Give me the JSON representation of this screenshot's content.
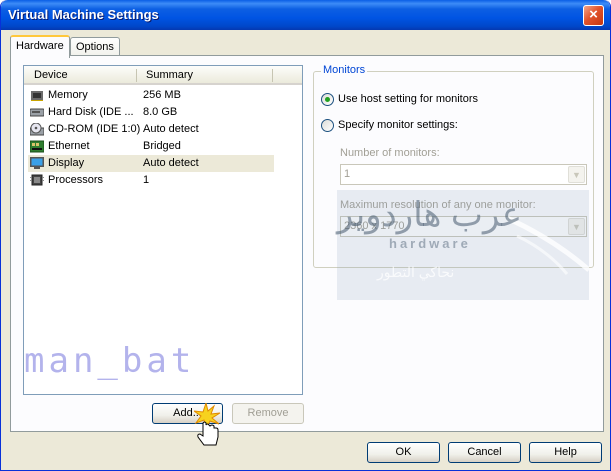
{
  "window": {
    "title": "Virtual Machine Settings",
    "close_glyph": "×"
  },
  "tabs": [
    {
      "label": "Hardware",
      "active": true
    },
    {
      "label": "Options",
      "active": false
    }
  ],
  "device_list": {
    "columns": {
      "device": "Device",
      "summary": "Summary"
    },
    "rows": [
      {
        "device": "Memory",
        "summary": "256 MB",
        "icon": "memory-icon"
      },
      {
        "device": "Hard Disk (IDE ...",
        "summary": "8.0 GB",
        "icon": "hard-disk-icon"
      },
      {
        "device": "CD-ROM (IDE 1:0)",
        "summary": "Auto detect",
        "icon": "cdrom-icon"
      },
      {
        "device": "Ethernet",
        "summary": "Bridged",
        "icon": "ethernet-icon"
      },
      {
        "device": "Display",
        "summary": "Auto detect",
        "icon": "display-icon",
        "selected": true
      },
      {
        "device": "Processors",
        "summary": "1",
        "icon": "processor-icon"
      }
    ],
    "watermark": "man_bat"
  },
  "list_buttons": {
    "add": "Add...",
    "remove": "Remove"
  },
  "monitors": {
    "legend": "Monitors",
    "option_host": "Use host setting for monitors",
    "option_specify": "Specify monitor settings:",
    "selected_option": "host",
    "number_label": "Number of monitors:",
    "number_value": "1",
    "resolution_label": "Maximum resolution of any one monitor:",
    "resolution_value": "2360 x 1770"
  },
  "overlay_logo": {
    "arabic_title": "عرب هاردوير",
    "latin": "hardware",
    "arabic_tagline": "نحاكي التطور"
  },
  "footer": {
    "ok": "OK",
    "cancel": "Cancel",
    "help": "Help"
  },
  "colors": {
    "title_blue": "#0054e3",
    "accent_orange": "#ffc83c",
    "group_legend": "#0046d5"
  }
}
